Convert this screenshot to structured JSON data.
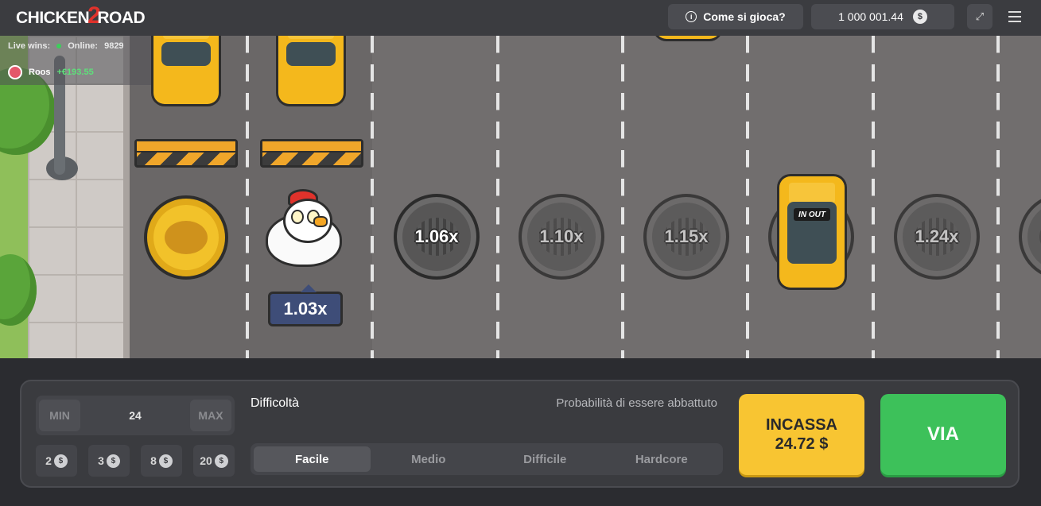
{
  "header": {
    "logo_left": "CHICKEN",
    "logo_num": "2",
    "logo_right": "ROAD",
    "how_to_play": "Come si gioca?",
    "balance": "1 000 001.44",
    "currency_symbol": "$"
  },
  "ticker": {
    "live_wins_label": "Live wins:",
    "online_label": "Online:",
    "online_count": "9829",
    "player_name": "Roos",
    "player_win": "+€193.55"
  },
  "game": {
    "chicken_multiplier": "1.03x",
    "manholes": [
      "1.06x",
      "1.10x",
      "1.15x",
      "1.24x"
    ],
    "car_sign": "IN OUT"
  },
  "controls": {
    "min_label": "MIN",
    "max_label": "MAX",
    "bet_value": "24",
    "chips": [
      "2",
      "3",
      "8",
      "20"
    ],
    "difficulty_label": "Difficoltà",
    "probability_label": "Probabilità di essere abbattuto",
    "difficulties": [
      "Facile",
      "Medio",
      "Difficile",
      "Hardcore"
    ],
    "selected_difficulty": "Facile",
    "cashout_label": "INCASSA",
    "cashout_amount": "24.72 $",
    "go_label": "VIA"
  },
  "colors": {
    "cashout": "#f8c532",
    "go": "#3dc15a",
    "win_green": "#5ee07a"
  }
}
